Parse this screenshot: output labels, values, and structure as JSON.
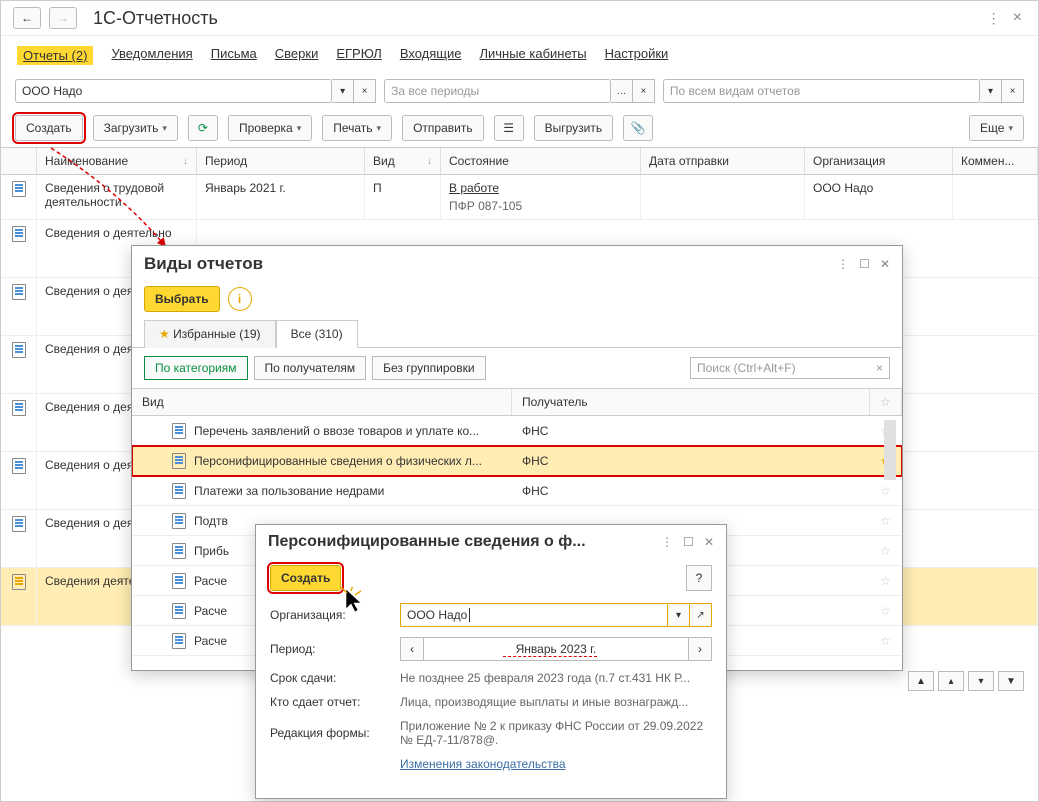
{
  "titlebar": {
    "title": "1С-Отчетность"
  },
  "tabs": [
    {
      "label": "Отчеты (2)",
      "active": true
    },
    {
      "label": "Уведомления"
    },
    {
      "label": "Письма"
    },
    {
      "label": "Сверки"
    },
    {
      "label": "ЕГРЮЛ"
    },
    {
      "label": "Входящие"
    },
    {
      "label": "Личные кабинеты"
    },
    {
      "label": "Настройки"
    }
  ],
  "filters": {
    "org": "ООО Надо",
    "period_placeholder": "За все периоды",
    "type_placeholder": "По всем видам отчетов"
  },
  "toolbar": {
    "create": "Создать",
    "load": "Загрузить",
    "check": "Проверка",
    "print": "Печать",
    "send": "Отправить",
    "export": "Выгрузить",
    "more": "Еще"
  },
  "grid": {
    "headers": {
      "name": "Наименование",
      "period": "Период",
      "vid": "Вид",
      "status": "Состояние",
      "sent": "Дата отправки",
      "org": "Организация",
      "comment": "Коммен..."
    },
    "row0": {
      "name": "Сведения о трудовой деятельности",
      "period": "Январь 2021 г.",
      "vid": "П",
      "status": "В работе",
      "status_sub": "ПФР 087-105",
      "org": "ООО Надо"
    },
    "row_partial": [
      "Сведения о деятельно"
    ],
    "selected_partial": "Сведения деятельно"
  },
  "modal1": {
    "title": "Виды отчетов",
    "select": "Выбрать",
    "tab_fav": "Избранные (19)",
    "tab_all": "Все (310)",
    "sub_cat": "По категориям",
    "sub_recv": "По получателям",
    "sub_nogroup": "Без группировки",
    "search_placeholder": "Поиск (Ctrl+Alt+F)",
    "col_vid": "Вид",
    "col_recv": "Получатель",
    "rows": [
      {
        "name": "Перечень заявлений о ввозе товаров и уплате ко...",
        "recv": "ФНС",
        "star": false
      },
      {
        "name": "Персонифицированные сведения о физических л...",
        "recv": "ФНС",
        "star": true,
        "hl": true
      },
      {
        "name": "Платежи за пользование недрами",
        "recv": "ФНС",
        "star": false
      },
      {
        "name": "Подтв",
        "recv": ""
      },
      {
        "name": "Прибь",
        "recv": ""
      },
      {
        "name": "Расче",
        "recv": ""
      },
      {
        "name": "Расче",
        "recv": ""
      },
      {
        "name": "Расче",
        "recv": ""
      }
    ]
  },
  "modal2": {
    "title": "Персонифицированные сведения о ф...",
    "create": "Создать",
    "help": "?",
    "org_label": "Организация:",
    "org_value": "ООО Надо",
    "period_label": "Период:",
    "period_value": "Январь 2023 г.",
    "deadline_label": "Срок сдачи:",
    "deadline_value": "Не позднее 25 февраля 2023 года (п.7 ст.431 НК Р...",
    "who_label": "Кто сдает отчет:",
    "who_value": "Лица, производящие выплаты и иные вознагражд...",
    "edition_label": "Редакция формы:",
    "edition_value": "Приложение № 2 к приказу ФНС России от 29.09.2022 № ЕД-7-11/878@.",
    "changes_link": "Изменения законодательства"
  }
}
